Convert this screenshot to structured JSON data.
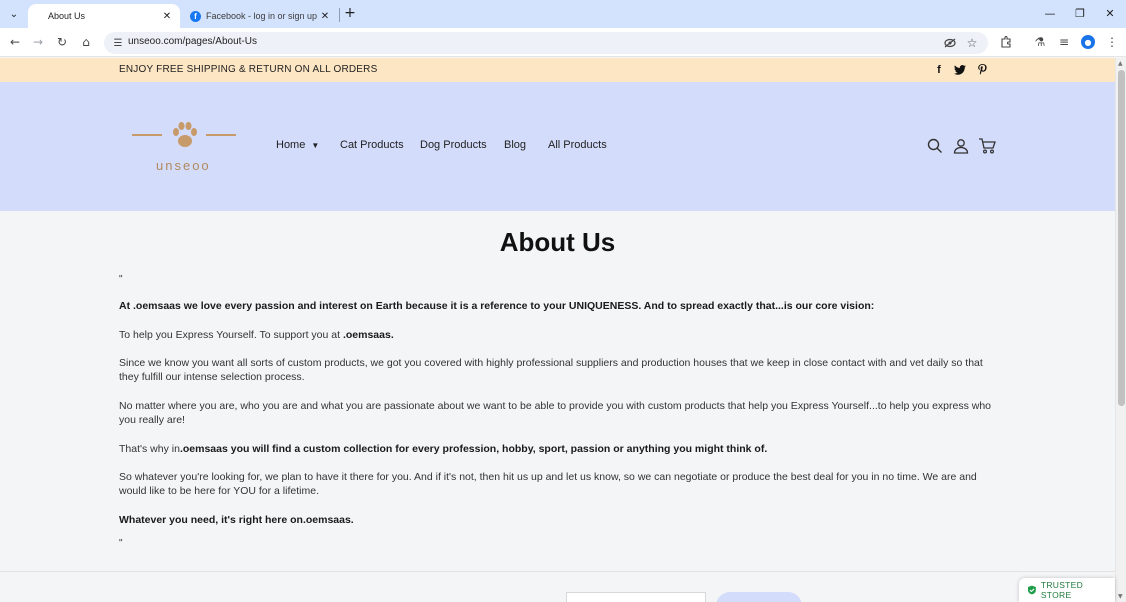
{
  "browser": {
    "tabs": [
      {
        "title": "About Us",
        "active": true
      },
      {
        "title": "Facebook - log in or sign up",
        "active": false
      }
    ],
    "url": "unseoo.com/pages/About-Us"
  },
  "announcement": {
    "text": "ENJOY FREE SHIPPING & RETURN ON ALL ORDERS",
    "social": [
      "facebook-icon",
      "twitter-icon",
      "pinterest-icon"
    ]
  },
  "header": {
    "logo_text": "unseoo",
    "nav": [
      {
        "label": "Home",
        "has_dropdown": true
      },
      {
        "label": "Cat Products"
      },
      {
        "label": "Dog Products"
      },
      {
        "label": "Blog"
      },
      {
        "label": "All Products"
      }
    ],
    "icons": [
      "search-icon",
      "account-icon",
      "cart-icon"
    ],
    "colors": {
      "background": "#d3dcfa",
      "announcement": "#fde6c4",
      "logo": "#c79a6a"
    }
  },
  "content": {
    "title": "About Us",
    "open_quote": "\"",
    "close_quote": "\"",
    "p1": "At .oemsaas we love every passion and interest on Earth because it is a reference to your UNIQUENESS. And to spread exactly that...is our core vision:",
    "p2_prefix": "To help you Express Yourself. To support you at ",
    "p2_bold": ".oemsaas.",
    "p3": "Since we know you want all sorts of custom products, we got you covered with highly professional suppliers and production houses that we keep in close contact with and vet daily so that they fulfill our intense selection process.",
    "p4": "No matter where you are, who you are and what you are passionate about we want to be able to provide you with custom products that help you Express Yourself...to help you express who you really are!",
    "p5_prefix": "That's why in",
    "p5_bold": ".oemsaas you will find a custom collection for every profession, hobby, sport, passion or anything you might think of.",
    "p6": "So whatever you're looking for, we plan to have it there for you. And if it's not, then hit us up and let us know, so we can negotiate or produce the best deal for you in no time. We are and would like to be here for YOU for a lifetime.",
    "p7": "Whatever you need, it's right here on.oemsaas."
  },
  "badge": {
    "text": "TRUSTED STORE"
  }
}
